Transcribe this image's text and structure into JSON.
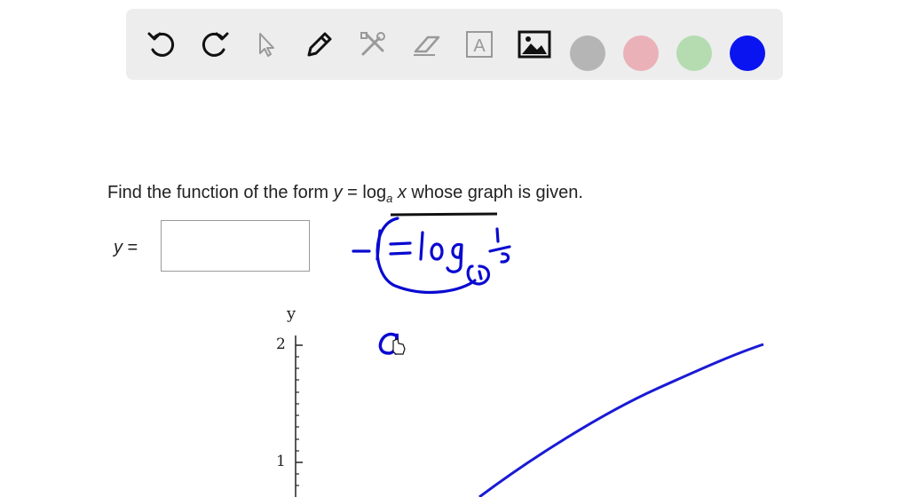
{
  "toolbar": {
    "tools": [
      {
        "name": "undo-icon"
      },
      {
        "name": "redo-icon"
      },
      {
        "name": "pointer-icon"
      },
      {
        "name": "pen-icon"
      },
      {
        "name": "tools-icon"
      },
      {
        "name": "eraser-icon"
      },
      {
        "name": "text-icon",
        "glyph": "A"
      },
      {
        "name": "image-icon"
      }
    ],
    "colors": [
      "#b5b5b5",
      "#eab1b8",
      "#b4dcb0",
      "#0a14f0"
    ]
  },
  "question": {
    "prefix": "Find the function of the form ",
    "y": "y",
    "eq": " = log",
    "base": "a",
    "x": " x",
    "suffix": " whose graph is given."
  },
  "answer": {
    "y": "y",
    "eq": " =",
    "value": ""
  },
  "chart_data": {
    "type": "line",
    "ylabel": "y",
    "y_ticks": [
      "2",
      "1"
    ],
    "ylim": [
      0,
      2
    ],
    "series": [
      {
        "function": "log_a(x)",
        "color": "#1a1ad6"
      }
    ]
  },
  "annotations": {
    "ink_color": "#0a0ad0",
    "handwritten": "-1 = log_a 1/2",
    "handwritten_2": "a"
  }
}
